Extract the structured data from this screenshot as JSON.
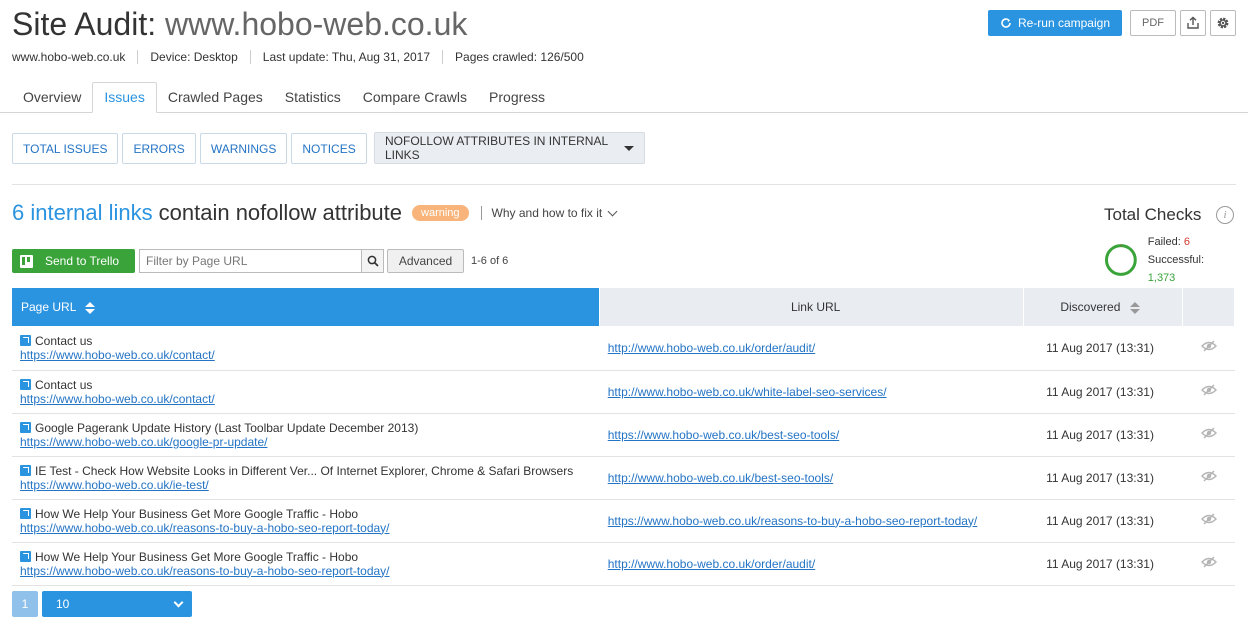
{
  "header": {
    "title_prefix": "Site Audit: ",
    "title_domain": "www.hobo-web.co.uk",
    "meta": {
      "domain": "www.hobo-web.co.uk",
      "device": "Device: Desktop",
      "last_update": "Last update: Thu, Aug 31, 2017",
      "pages_crawled": "Pages crawled: 126/500"
    },
    "actions": {
      "rerun_label": "Re-run campaign",
      "pdf_label": "PDF"
    }
  },
  "tabs": [
    {
      "label": "Overview",
      "active": false
    },
    {
      "label": "Issues",
      "active": true
    },
    {
      "label": "Crawled Pages",
      "active": false
    },
    {
      "label": "Statistics",
      "active": false
    },
    {
      "label": "Compare Crawls",
      "active": false
    },
    {
      "label": "Progress",
      "active": false
    }
  ],
  "filters": {
    "total_issues": "TOTAL ISSUES",
    "errors": "ERRORS",
    "warnings": "WARNINGS",
    "notices": "NOTICES",
    "selected_issue": "NOFOLLOW ATTRIBUTES IN INTERNAL LINKS"
  },
  "issue": {
    "count_text": "6 internal links",
    "rest_text": "contain nofollow attribute",
    "badge": "warning",
    "why_fix": "Why and how to fix it"
  },
  "total_checks": {
    "title": "Total Checks",
    "failed_label": "Failed: ",
    "failed": "6",
    "successful_label": "Successful: ",
    "successful": "1,373"
  },
  "toolbar": {
    "trello_label": "Send to Trello",
    "filter_placeholder": "Filter by Page URL",
    "advanced_label": "Advanced",
    "result_count": "1-6 of 6"
  },
  "table": {
    "headers": {
      "page_url": "Page URL",
      "link_url": "Link URL",
      "discovered": "Discovered"
    },
    "rows": [
      {
        "page_title": "Contact us",
        "page_url": "https://www.hobo-web.co.uk/contact/",
        "link_url": "http://www.hobo-web.co.uk/order/audit/",
        "discovered": "11 Aug 2017 (13:31)"
      },
      {
        "page_title": "Contact us",
        "page_url": "https://www.hobo-web.co.uk/contact/",
        "link_url": "http://www.hobo-web.co.uk/white-label-seo-services/",
        "discovered": "11 Aug 2017 (13:31)"
      },
      {
        "page_title": "Google Pagerank Update History (Last Toolbar Update December 2013)",
        "page_url": "https://www.hobo-web.co.uk/google-pr-update/",
        "link_url": "https://www.hobo-web.co.uk/best-seo-tools/",
        "discovered": "11 Aug 2017 (13:31)"
      },
      {
        "page_title": "IE Test - Check How Website Looks in Different Ver... Of Internet Explorer, Chrome & Safari Browsers",
        "page_url": "https://www.hobo-web.co.uk/ie-test/",
        "link_url": "http://www.hobo-web.co.uk/best-seo-tools/",
        "discovered": "11 Aug 2017 (13:31)"
      },
      {
        "page_title": "How We Help Your Business Get More Google Traffic - Hobo",
        "page_url": "https://www.hobo-web.co.uk/reasons-to-buy-a-hobo-seo-report-today/",
        "link_url": "https://www.hobo-web.co.uk/reasons-to-buy-a-hobo-seo-report-today/",
        "discovered": "11 Aug 2017 (13:31)"
      },
      {
        "page_title": "How We Help Your Business Get More Google Traffic - Hobo",
        "page_url": "https://www.hobo-web.co.uk/reasons-to-buy-a-hobo-seo-report-today/",
        "link_url": "http://www.hobo-web.co.uk/order/audit/",
        "discovered": "11 Aug 2017 (13:31)"
      }
    ]
  },
  "pagination": {
    "current_page": "1",
    "per_page": "10"
  },
  "colors": {
    "accent": "#2b94e1",
    "success": "#3aa33a",
    "failed": "#d0392e",
    "warning_badge": "#f8b47a"
  },
  "icons": {
    "rerun": "refresh-icon",
    "share": "share-icon",
    "settings": "gear-icon",
    "info": "info-icon",
    "trello": "trello-icon",
    "search": "search-icon",
    "external": "external-link-icon",
    "hide": "eye-slash-icon"
  }
}
